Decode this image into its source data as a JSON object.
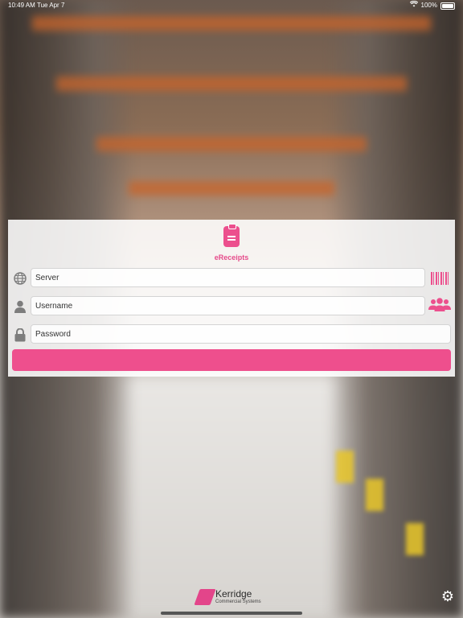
{
  "status_bar": {
    "time": "10:49 AM",
    "date": "Tue Apr 7",
    "battery": "100%"
  },
  "app": {
    "name": "eReceipts",
    "logo_icon": "clipboard-icon",
    "accent_color": "#ec4f8d"
  },
  "form": {
    "server_placeholder": "Server",
    "server_icon": "globe-icon",
    "barcode_icon": "barcode-icon",
    "username_placeholder": "Username",
    "username_icon": "user-icon",
    "users_icon": "users-group-icon",
    "password_placeholder": "Password",
    "password_icon": "lock-icon",
    "login_label": ""
  },
  "footer": {
    "brand_name": "Kerridge",
    "brand_sub": "Commercial Systems",
    "settings_icon": "gear-icon"
  }
}
